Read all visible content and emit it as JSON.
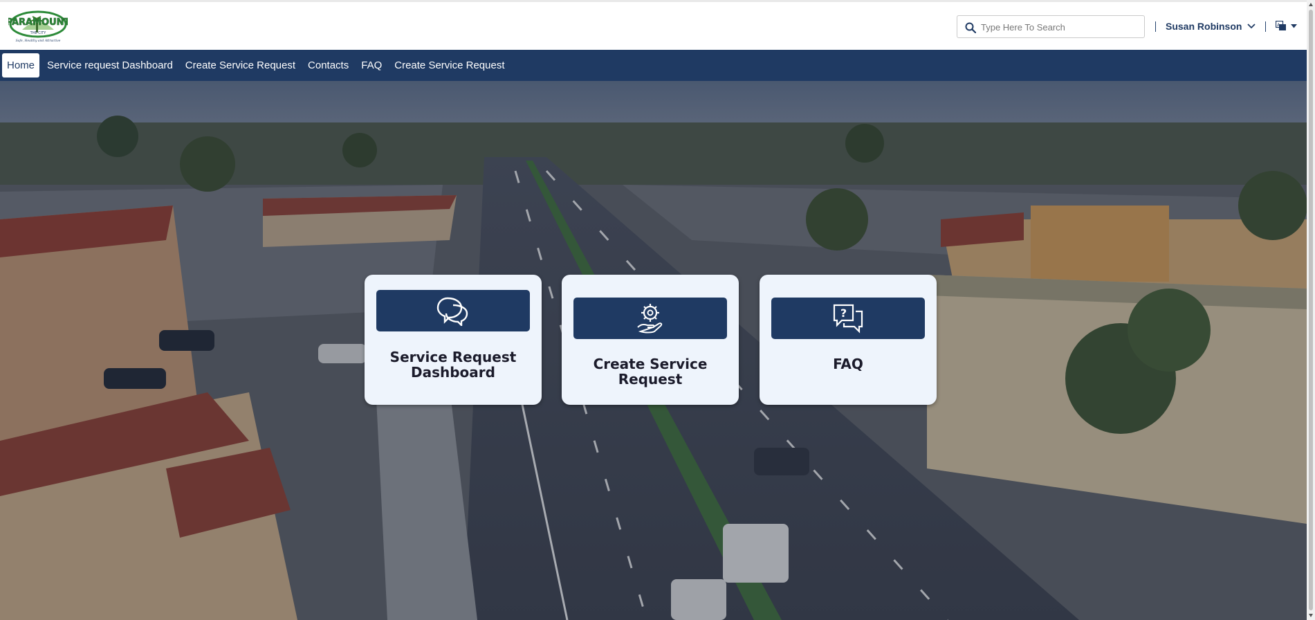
{
  "header": {
    "logo_text": "PARAMOUNT",
    "logo_sub": "THE CITY",
    "logo_tagline": "Safe, Healthy and Attractive",
    "search_placeholder": "Type Here To Search",
    "user_name": "Susan Robinson"
  },
  "nav": {
    "items": [
      {
        "label": "Home",
        "active": true
      },
      {
        "label": "Service request Dashboard"
      },
      {
        "label": "Create Service Request"
      },
      {
        "label": "Contacts"
      },
      {
        "label": "FAQ"
      },
      {
        "label": "Create Service Request"
      }
    ]
  },
  "cards": [
    {
      "title_line1": "Service Request",
      "title_line2": "Dashboard",
      "icon": "chat-bubbles-icon"
    },
    {
      "title_line1": "Create Service Request",
      "title_line2": "",
      "icon": "gear-in-hand-icon"
    },
    {
      "title_line1": "FAQ",
      "title_line2": "",
      "icon": "question-chat-icon"
    }
  ],
  "colors": {
    "brand_navy": "#1f3a63",
    "card_bg": "#eef4fc",
    "logo_green": "#2e8b3a"
  }
}
